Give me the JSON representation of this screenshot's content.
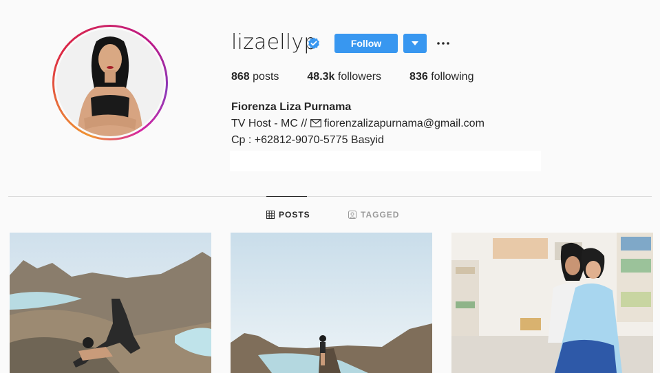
{
  "profile": {
    "username": "lizaellyp",
    "follow_label": "Follow",
    "posts_count": "868",
    "posts_label": "posts",
    "followers_count": "48.3k",
    "followers_label": "followers",
    "following_count": "836",
    "following_label": "following",
    "full_name": "Fiorenza Liza Purnama",
    "bio_line1_prefix": "TV Host - MC // ",
    "bio_email": "fiorenzalizapurnama@gmail.com",
    "bio_line2": "Cp : +62812-9070-5775 Basyid"
  },
  "tabs": [
    {
      "label": "POSTS",
      "icon": "grid-icon",
      "active": true
    },
    {
      "label": "TAGGED",
      "icon": "tagged-icon",
      "active": false
    }
  ],
  "colors": {
    "accent": "#3897f0",
    "text": "#262626",
    "muted": "#999999",
    "background": "#fafafa"
  },
  "posts": [
    {
      "subject": "yoga pose on hilltop overlooking bays"
    },
    {
      "subject": "woman standing on hill with sea view"
    },
    {
      "subject": "mother and daughter in room"
    }
  ]
}
